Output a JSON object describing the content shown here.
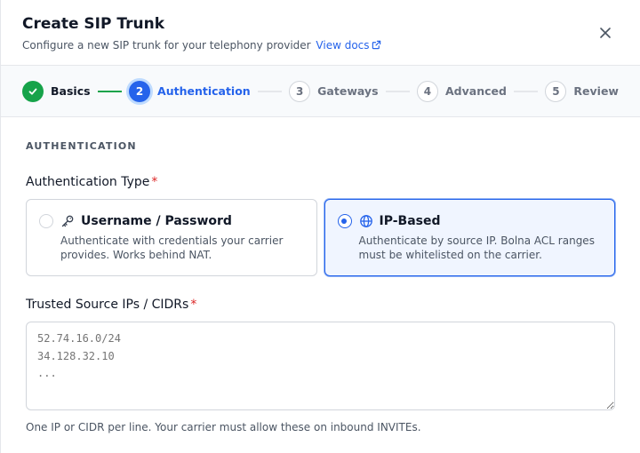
{
  "header": {
    "title": "Create SIP Trunk",
    "subtitle": "Configure a new SIP trunk for your telephony provider",
    "docs_link": "View docs"
  },
  "stepper": {
    "steps": [
      {
        "number": "1",
        "label": "Basics",
        "state": "done"
      },
      {
        "number": "2",
        "label": "Authentication",
        "state": "active"
      },
      {
        "number": "3",
        "label": "Gateways",
        "state": "todo"
      },
      {
        "number": "4",
        "label": "Advanced",
        "state": "todo"
      },
      {
        "number": "5",
        "label": "Review",
        "state": "todo"
      }
    ]
  },
  "section": {
    "title": "AUTHENTICATION"
  },
  "auth_type": {
    "label": "Authentication Type",
    "required_mark": "*",
    "options": [
      {
        "title": "Username / Password",
        "description": "Authenticate with credentials your carrier provides. Works behind NAT.",
        "icon": "key-icon",
        "selected": false
      },
      {
        "title": "IP-Based",
        "description": "Authenticate by source IP. Bolna ACL ranges must be whitelisted on the carrier.",
        "icon": "globe-icon",
        "selected": true
      }
    ]
  },
  "trusted_ips": {
    "label": "Trusted Source IPs / CIDRs",
    "required_mark": "*",
    "placeholder": "52.74.16.0/24\n34.128.32.10\n...",
    "value": "",
    "hint": "One IP or CIDR per line. Your carrier must allow these on inbound INVITEs."
  },
  "colors": {
    "accent": "#2563eb",
    "success": "#16a34a",
    "required": "#dc2626"
  }
}
